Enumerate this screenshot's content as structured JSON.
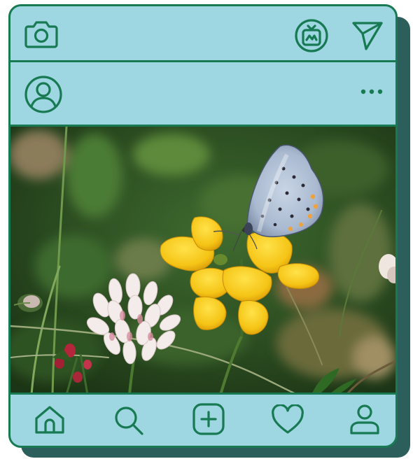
{
  "app": {
    "frame_color": "#177a52",
    "background_color": "#9ed6e2",
    "shadow_color": "#2c5f5c"
  },
  "header": {
    "left_icon": "camera-icon",
    "right_icons": [
      "igtv-icon",
      "send-icon"
    ]
  },
  "post": {
    "author_icon": "user-avatar-icon",
    "more_icon": "more-options-icon",
    "image_subject": "butterfly-on-flower-photo"
  },
  "bottom_nav": {
    "items": [
      "home-icon",
      "search-icon",
      "add-post-icon",
      "heart-icon",
      "profile-icon"
    ]
  }
}
